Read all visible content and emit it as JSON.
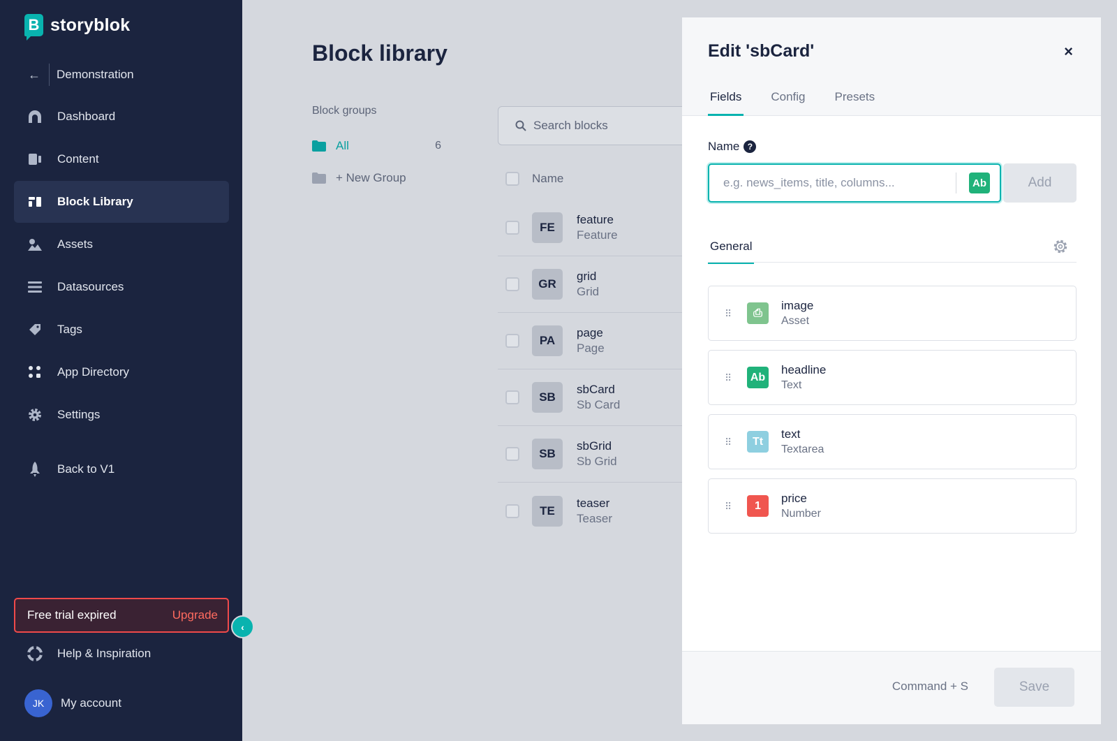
{
  "sidebar": {
    "logo_text": "storyblok",
    "logo_mark": "B",
    "back_label": "Demonstration",
    "nav": [
      {
        "label": "Dashboard",
        "icon": "dashboard-icon"
      },
      {
        "label": "Content",
        "icon": "content-icon"
      },
      {
        "label": "Block Library",
        "icon": "block-library-icon",
        "active": true
      },
      {
        "label": "Assets",
        "icon": "assets-icon"
      },
      {
        "label": "Datasources",
        "icon": "datasources-icon"
      },
      {
        "label": "Tags",
        "icon": "tag-icon"
      },
      {
        "label": "App Directory",
        "icon": "app-directory-icon"
      },
      {
        "label": "Settings",
        "icon": "gear-icon"
      },
      {
        "label": "Back to V1",
        "icon": "rocket-icon"
      }
    ],
    "trial_text": "Free trial expired",
    "upgrade_label": "Upgrade",
    "help_label": "Help & Inspiration",
    "account_label": "My account",
    "avatar_initials": "JK"
  },
  "main": {
    "title": "Block library",
    "groups_label": "Block groups",
    "groups": [
      {
        "label": "All",
        "count": "6"
      },
      {
        "label": "+ New Group"
      }
    ],
    "search_placeholder": "Search blocks",
    "column_name": "Name",
    "blocks": [
      {
        "abbr": "FE",
        "name": "feature",
        "display": "Feature"
      },
      {
        "abbr": "GR",
        "name": "grid",
        "display": "Grid"
      },
      {
        "abbr": "PA",
        "name": "page",
        "display": "Page"
      },
      {
        "abbr": "SB",
        "name": "sbCard",
        "display": "Sb Card"
      },
      {
        "abbr": "SB",
        "name": "sbGrid",
        "display": "Sb Grid"
      },
      {
        "abbr": "TE",
        "name": "teaser",
        "display": "Teaser"
      }
    ]
  },
  "panel": {
    "title": "Edit 'sbCard'",
    "close": "×",
    "tabs": [
      "Fields",
      "Config",
      "Presets"
    ],
    "name_label": "Name",
    "help": "?",
    "name_placeholder": "e.g. news_items, title, columns...",
    "type_button": "Ab",
    "add_label": "Add",
    "section_tab": "General",
    "fields": [
      {
        "name": "image",
        "type": "Asset",
        "glyph": "⎙",
        "color": "#7fc48e"
      },
      {
        "name": "headline",
        "type": "Text",
        "glyph": "Ab",
        "color": "#20b27a"
      },
      {
        "name": "text",
        "type": "Textarea",
        "glyph": "Tt",
        "color": "#8ecfe0"
      },
      {
        "name": "price",
        "type": "Number",
        "glyph": "1",
        "color": "#f0564f"
      }
    ],
    "shortcut": "Command + S",
    "save_label": "Save"
  },
  "colors": {
    "accent": "#09b3af",
    "sidebar": "#1b243f",
    "danger": "#f04a4a"
  }
}
